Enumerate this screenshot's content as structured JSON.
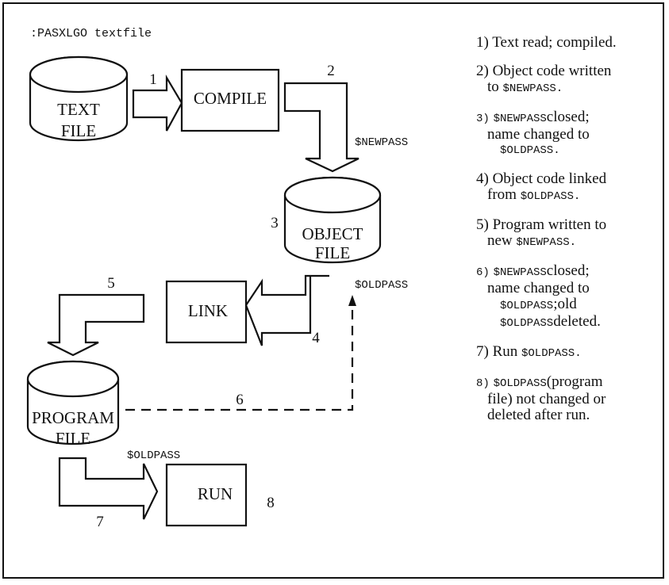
{
  "command": ":PASXLGO textfile",
  "nodes": {
    "text_file": [
      "TEXT",
      "FILE"
    ],
    "compile": "COMPILE",
    "object_file": [
      "OBJECT",
      "FILE"
    ],
    "link": "LINK",
    "program_file": [
      "PROGRAM",
      "FILE"
    ],
    "run": "RUN"
  },
  "step_labels": {
    "s1": "1",
    "s2": "2",
    "s3": "3",
    "s4": "4",
    "s5": "5",
    "s6": "6",
    "s7": "7",
    "s8": "8"
  },
  "file_labels": {
    "newpass": "$NEWPASS",
    "oldpass_link": "$OLDPASS",
    "oldpass_run": "$OLDPASS"
  },
  "notes": [
    {
      "line1": "1) Text read; compiled."
    },
    {
      "line1": "2) Object code written",
      "pre2": "to ",
      "mono2": "$NEWPASS."
    },
    {
      "num": "3)",
      "mono1": "$NEWPASS",
      "post1": "closed;",
      "line2": "name changed to",
      "mono3": "$OLDPASS."
    },
    {
      "line1": "4) Object code linked",
      "pre2": "from ",
      "mono2": "$OLDPASS."
    },
    {
      "line1": "5) Program written to",
      "pre2": "new ",
      "mono2": "$NEWPASS."
    },
    {
      "num": "6)",
      "mono1": "$NEWPASS",
      "post1": "closed;",
      "line2": "name changed to",
      "mono3": "$OLDPASS",
      "post3": ";old",
      "mono4": "$OLDPASS",
      "post4": "deleted."
    },
    {
      "pre1": "7) Run ",
      "mono1": "$OLDPASS."
    },
    {
      "num": "8)",
      "mono1": "$OLDPASS",
      "post1": "(program",
      "line2": "file) not changed or",
      "line3": "deleted after run."
    }
  ]
}
